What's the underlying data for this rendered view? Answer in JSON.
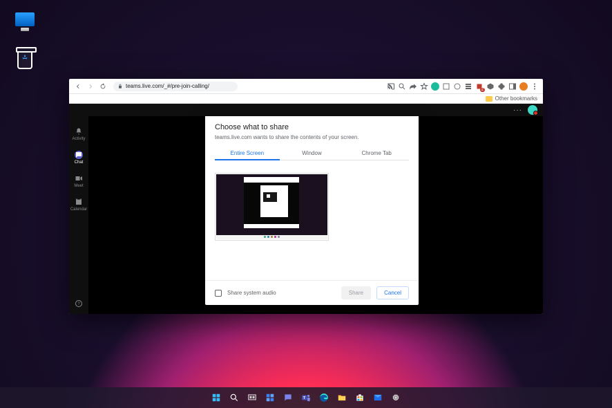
{
  "desktop": {
    "icons": {
      "this_pc": "",
      "recycle_bin": ""
    }
  },
  "browser": {
    "url": "teams.live.com/_#/pre-join-calling/",
    "bookmark_bar": {
      "other_bookmarks": "Other bookmarks"
    },
    "extension_colors": [
      "#1abc9c",
      "#999999",
      "#999999",
      "#505050",
      "#ffffff",
      "#d03030",
      "#505050",
      "#505050",
      "#505050",
      "#404040",
      "#e67e22"
    ]
  },
  "teams": {
    "rail": [
      {
        "label": "Activity",
        "key": "activity"
      },
      {
        "label": "Chat",
        "key": "chat"
      },
      {
        "label": "Meet",
        "key": "meet"
      },
      {
        "label": "Calendar",
        "key": "calendar"
      }
    ],
    "more": "···"
  },
  "dialog": {
    "title": "Choose what to share",
    "subtitle": "teams.live.com wants to share the contents of your screen.",
    "tabs": {
      "entire_screen": "Entire Screen",
      "window": "Window",
      "chrome_tab": "Chrome Tab"
    },
    "share_audio_label": "Share system audio",
    "share_button": "Share",
    "cancel_button": "Cancel"
  },
  "taskbar": {
    "items": [
      "start",
      "search",
      "task-view",
      "widgets",
      "chat",
      "teams",
      "edge",
      "file-explorer",
      "store",
      "mail",
      "settings"
    ]
  }
}
